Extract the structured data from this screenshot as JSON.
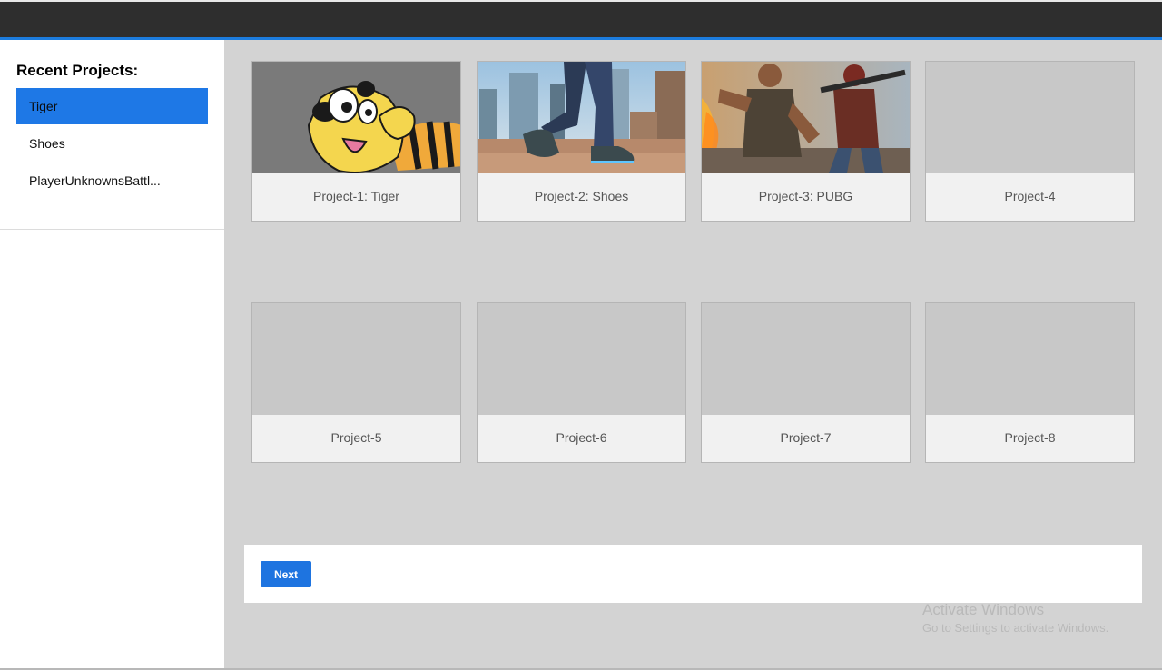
{
  "sidebar": {
    "title": "Recent Projects:",
    "items": [
      {
        "label": "Tiger",
        "active": true
      },
      {
        "label": "Shoes",
        "active": false
      },
      {
        "label": "PlayerUnknownsBattl...",
        "active": false
      }
    ]
  },
  "projects": [
    {
      "label": "Project-1: Tiger",
      "thumbnail": "tiger-cartoon"
    },
    {
      "label": "Project-2: Shoes",
      "thumbnail": "city-walking-legs"
    },
    {
      "label": "Project-3: PUBG",
      "thumbnail": "pubg-soldiers"
    },
    {
      "label": "Project-4",
      "thumbnail": "empty"
    },
    {
      "label": "Project-5",
      "thumbnail": "empty"
    },
    {
      "label": "Project-6",
      "thumbnail": "empty"
    },
    {
      "label": "Project-7",
      "thumbnail": "empty"
    },
    {
      "label": "Project-8",
      "thumbnail": "empty"
    }
  ],
  "footer": {
    "next_label": "Next"
  },
  "watermark": {
    "line1": "Activate Windows",
    "line2": "Go to Settings to activate Windows."
  },
  "colors": {
    "topbar": "#2e2e2e",
    "accent": "#1e78e6",
    "content_bg": "#d3d3d3"
  }
}
